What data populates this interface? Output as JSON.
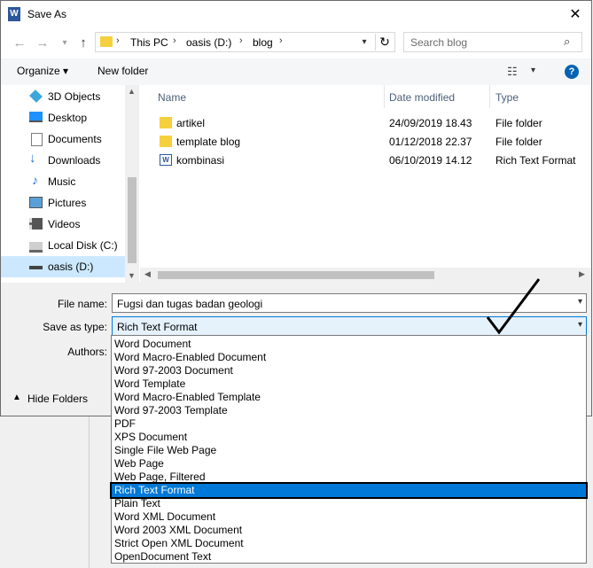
{
  "window": {
    "title": "Save As",
    "close_icon": "close-icon"
  },
  "address": {
    "crumbs": [
      "This PC",
      "oasis  (D:)",
      "blog"
    ],
    "search_placeholder": "Search blog"
  },
  "toolbar": {
    "organize": "Organize ▾",
    "new_folder": "New folder"
  },
  "nav": {
    "items": [
      {
        "label": "3D Objects",
        "icon": "cube-icon",
        "color": "#3aa7dc"
      },
      {
        "label": "Desktop",
        "icon": "desktop-icon",
        "color": "#1e90ff"
      },
      {
        "label": "Documents",
        "icon": "documents-icon",
        "color": "#7a7a7a"
      },
      {
        "label": "Downloads",
        "icon": "download-icon",
        "color": "#1e6fd9"
      },
      {
        "label": "Music",
        "icon": "music-icon",
        "color": "#1e6fd9"
      },
      {
        "label": "Pictures",
        "icon": "pictures-icon",
        "color": "#5aa0d8"
      },
      {
        "label": "Videos",
        "icon": "videos-icon",
        "color": "#555555"
      },
      {
        "label": "Local Disk (C:)",
        "icon": "disk-icon",
        "color": "#666666"
      },
      {
        "label": "oasis  (D:)",
        "icon": "drive-icon",
        "color": "#444444"
      }
    ],
    "selected_index": 8
  },
  "columns": {
    "name": "Name",
    "date": "Date modified",
    "type": "Type"
  },
  "files": [
    {
      "name": "artikel",
      "date": "24/09/2019 18.43",
      "type": "File folder",
      "icon": "folder-icon"
    },
    {
      "name": "template blog",
      "date": "01/12/2018 22.37",
      "type": "File folder",
      "icon": "folder-icon"
    },
    {
      "name": "kombinasi",
      "date": "06/10/2019 14.12",
      "type": "Rich Text Format",
      "icon": "word-doc-icon"
    }
  ],
  "form": {
    "file_name_label": "File name:",
    "file_name_value": "Fugsi dan tugas badan geologi",
    "save_type_label": "Save as type:",
    "save_type_value": "Rich Text Format",
    "authors_label": "Authors:",
    "hide_folders": "Hide Folders"
  },
  "save_type_options": [
    "Word Document",
    "Word Macro-Enabled Document",
    "Word 97-2003 Document",
    "Word Template",
    "Word Macro-Enabled Template",
    "Word 97-2003 Template",
    "PDF",
    "XPS Document",
    "Single File Web Page",
    "Web Page",
    "Web Page, Filtered",
    "Rich Text Format",
    "Plain Text",
    "Word XML Document",
    "Word 2003 XML Document",
    "Strict Open XML Document",
    "OpenDocument Text"
  ],
  "selected_option_index": 11,
  "colors": {
    "accent": "#0078d7",
    "nav_selected": "#cce8ff",
    "folder": "#f6cf3e"
  }
}
